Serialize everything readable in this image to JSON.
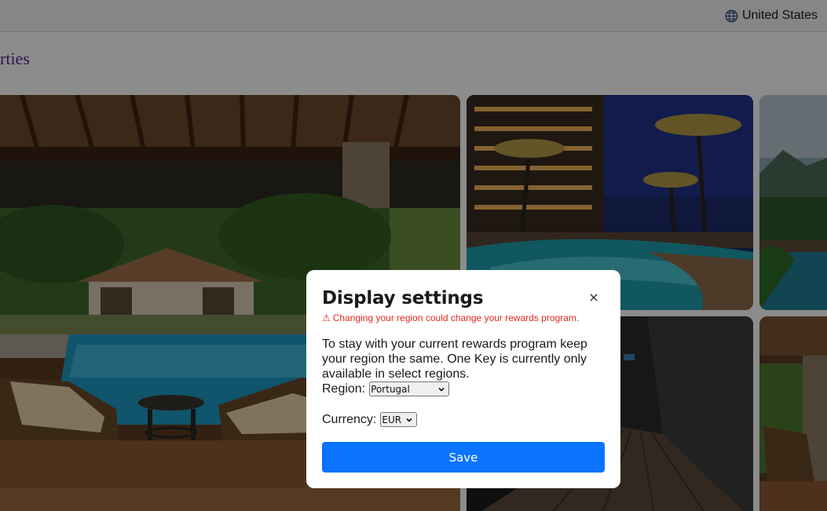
{
  "header": {
    "region_label": "United States"
  },
  "section": {
    "heading_partial": "rties"
  },
  "modal": {
    "title": "Display settings",
    "close_label": "×",
    "warning_icon": "⚠",
    "warning_text": "Changing your region could change your rewards program.",
    "body_text": "To stay with your current rewards program keep your region the same. One Key is currently only available in select regions.",
    "region": {
      "label": "Region:",
      "selected": "Portugal"
    },
    "currency": {
      "label": "Currency:",
      "selected": "EUR"
    },
    "save_label": "Save"
  },
  "icons": {
    "region": "globe-icon",
    "dropdown": "chevron-down-icon",
    "close": "close-icon",
    "warning": "warning-icon"
  },
  "colors": {
    "primary_button": "#0a74ff",
    "warning": "#e0281f",
    "heading": "#5b2a8c",
    "overlay": "rgba(0,0,0,0.45)"
  }
}
